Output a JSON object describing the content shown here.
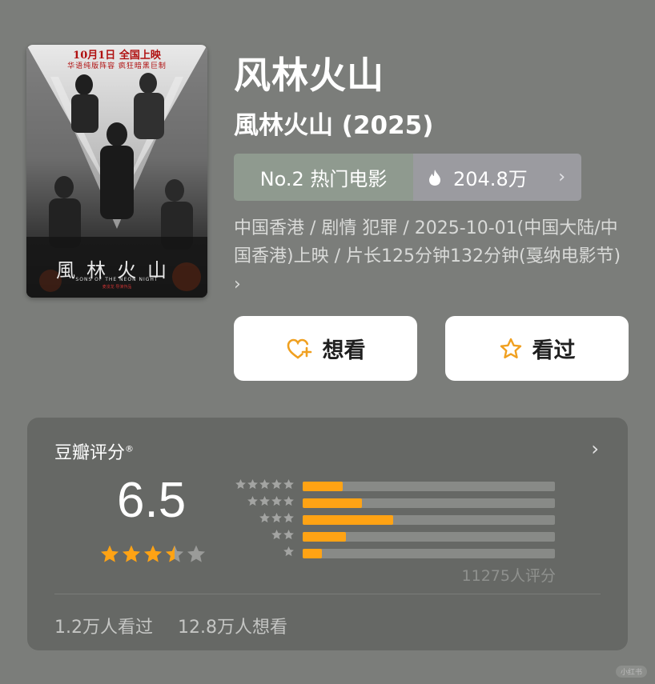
{
  "poster": {
    "date_line": "10月1日  全国上映",
    "tagline": "华语纯版阵容  疯狂暗黑巨制",
    "title": "風林火山",
    "english": "SONS OF THE NEON NIGHT",
    "credit": "麦浚龙 导演作品"
  },
  "movie": {
    "title": "风林火山",
    "original_title": "風林火山 (2025)"
  },
  "rank": {
    "label": "No.2 热门电影",
    "heat": "204.8万",
    "chevron": "›"
  },
  "info": {
    "text": "中国香港 / 剧情 犯罪 / 2025-10-01(中国大陆/中国香港)上映 / 片长125分钟132分钟(戛纳电影节) ›"
  },
  "buttons": {
    "want": "想看",
    "seen": "看过"
  },
  "rating": {
    "title": "豆瓣评分",
    "registered": "®",
    "chevron": "›",
    "score": "6.5",
    "stars_value": 3.5,
    "distribution": [
      {
        "stars": 5,
        "fraction": 0.16
      },
      {
        "stars": 4,
        "fraction": 0.235
      },
      {
        "stars": 3,
        "fraction": 0.36
      },
      {
        "stars": 2,
        "fraction": 0.17
      },
      {
        "stars": 1,
        "fraction": 0.075
      }
    ],
    "count": "11275人评分",
    "seen_count": "1.2万人看过",
    "want_count": "12.8万人想看"
  },
  "colors": {
    "accent": "#ffa314",
    "background": "#7b7d7a",
    "card": "#666865"
  },
  "watermark": "小红书"
}
